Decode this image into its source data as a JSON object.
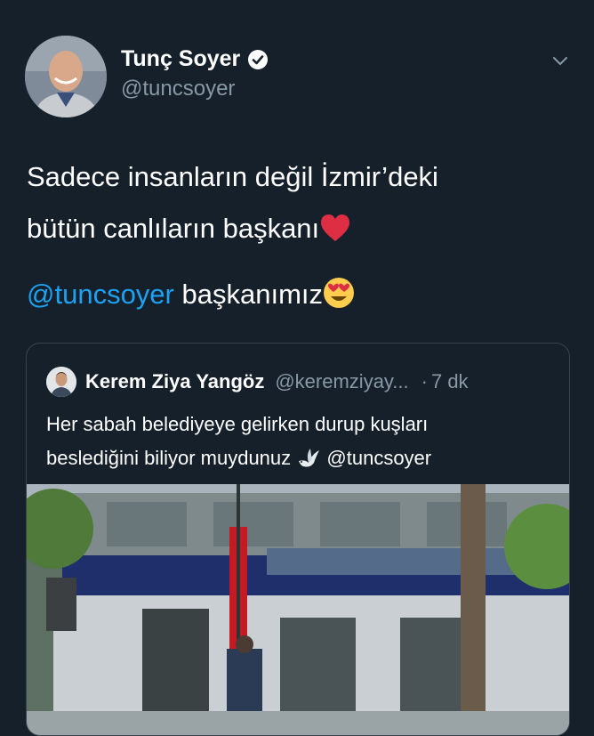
{
  "author": {
    "name": "Tunç Soyer",
    "handle": "@tuncsoyer",
    "avatar_icon": "profile-photo",
    "verified_icon": "verified-badge-icon"
  },
  "tweet": {
    "line1": "Sadece insanların değil İzmir’deki",
    "line2": "bütün canlıların başkanı",
    "line2_emoji": "red-heart-emoji",
    "mention": "@tuncsoyer",
    "line3_rest": " başkanımız",
    "line3_emoji": "heart-eyes-emoji"
  },
  "quoted_tweet": {
    "name": "Kerem Ziya Yangöz",
    "handle": "@keremziyay...",
    "separator": "·",
    "time": "7 dk",
    "text_line1": "Her sabah belediyeye gelirken durup kuşları",
    "text_line2_a": "beslediğini biliyor muydunuz",
    "text_line2_emoji": "dove-emoji",
    "text_line2_mention": "@tuncsoyer"
  },
  "colors": {
    "background": "#15202b",
    "text": "#ffffff",
    "secondary": "#8899a6",
    "link": "#1da1f2",
    "border": "#38444d"
  }
}
